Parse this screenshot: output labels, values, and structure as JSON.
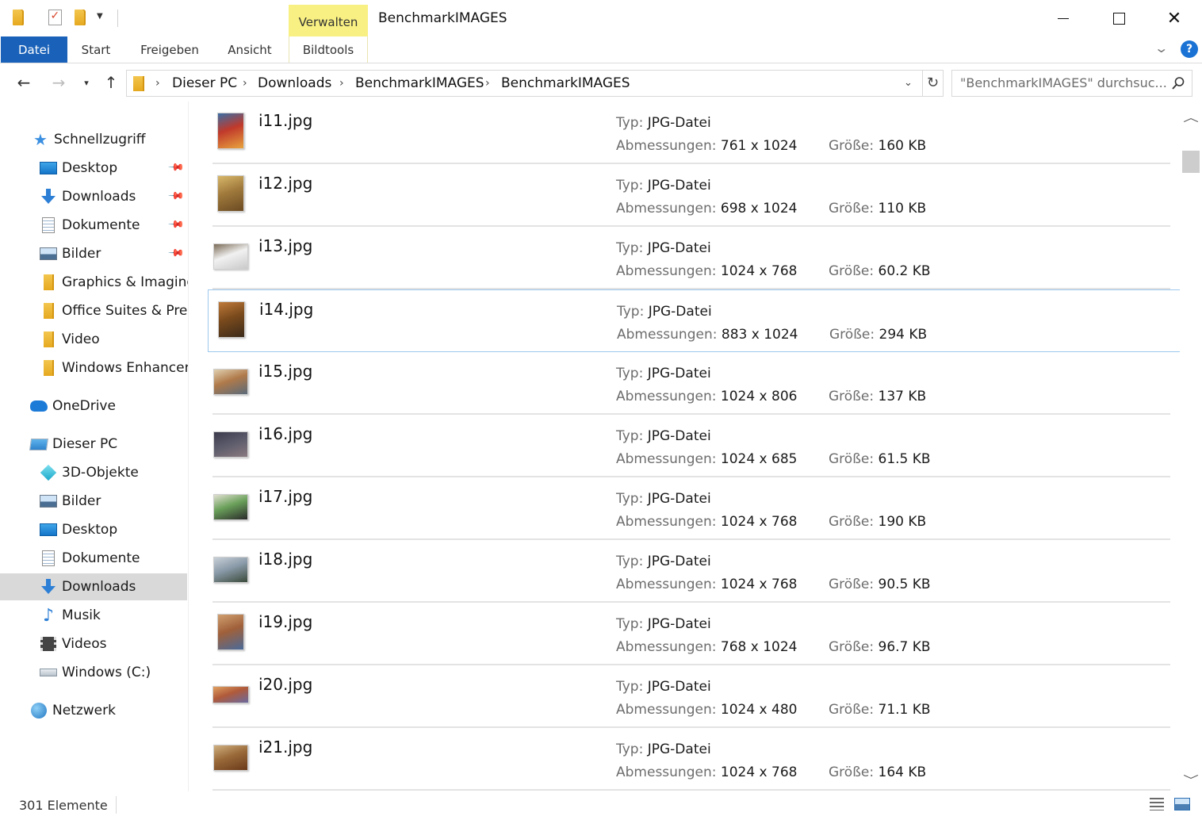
{
  "window": {
    "title": "BenchmarkIMAGES",
    "context_tab_header": "Verwalten"
  },
  "ribbon": {
    "tabs": [
      "Datei",
      "Start",
      "Freigeben",
      "Ansicht",
      "Bildtools"
    ],
    "help_label": "?"
  },
  "address": {
    "breadcrumbs": [
      "Dieser PC",
      "Downloads",
      "BenchmarkIMAGES",
      "BenchmarkIMAGES"
    ]
  },
  "search": {
    "placeholder": "\"BenchmarkIMAGES\" durchsuc..."
  },
  "navpane": {
    "quick_access": {
      "label": "Schnellzugriff",
      "items": [
        {
          "label": "Desktop",
          "icon": "desktop-icon",
          "pinned": true
        },
        {
          "label": "Downloads",
          "icon": "downloads-icon",
          "pinned": true
        },
        {
          "label": "Dokumente",
          "icon": "documents-icon",
          "pinned": true
        },
        {
          "label": "Bilder",
          "icon": "pictures-icon",
          "pinned": true
        },
        {
          "label": "Graphics & Imaging",
          "icon": "folder-icon",
          "pinned": false
        },
        {
          "label": "Office Suites & Pres",
          "icon": "folder-icon",
          "pinned": false
        },
        {
          "label": "Video",
          "icon": "folder-icon",
          "pinned": false
        },
        {
          "label": "Windows Enhancers",
          "icon": "folder-icon",
          "pinned": false
        }
      ]
    },
    "onedrive": {
      "label": "OneDrive"
    },
    "this_pc": {
      "label": "Dieser PC",
      "items": [
        {
          "label": "3D-Objekte",
          "icon": "3d-objects-icon"
        },
        {
          "label": "Bilder",
          "icon": "pictures-icon"
        },
        {
          "label": "Desktop",
          "icon": "desktop-icon"
        },
        {
          "label": "Dokumente",
          "icon": "documents-icon"
        },
        {
          "label": "Downloads",
          "icon": "downloads-icon",
          "selected": true
        },
        {
          "label": "Musik",
          "icon": "music-icon"
        },
        {
          "label": "Videos",
          "icon": "videos-icon"
        },
        {
          "label": "Windows (C:)",
          "icon": "drive-icon"
        }
      ]
    },
    "network": {
      "label": "Netzwerk"
    }
  },
  "labels": {
    "type": "Typ:",
    "dimensions": "Abmessungen:",
    "size": "Größe:"
  },
  "files": [
    {
      "name": "i11.jpg",
      "type": "JPG-Datei",
      "dimensions": "761 x 1024",
      "size": "160 KB",
      "thumb_colors": [
        "#c0392b",
        "#e8a33d",
        "#3a6ea5"
      ],
      "orientation": "portrait"
    },
    {
      "name": "i12.jpg",
      "type": "JPG-Datei",
      "dimensions": "698 x 1024",
      "size": "110 KB",
      "thumb_colors": [
        "#a07a3c",
        "#6b4a22",
        "#d8b86a"
      ],
      "orientation": "portrait"
    },
    {
      "name": "i13.jpg",
      "type": "JPG-Datei",
      "dimensions": "1024 x 768",
      "size": "60.2 KB",
      "thumb_colors": [
        "#f1f1f1",
        "#c9c9c9",
        "#7a6a55"
      ],
      "orientation": "landscape"
    },
    {
      "name": "i14.jpg",
      "type": "JPG-Datei",
      "dimensions": "883 x 1024",
      "size": "294 KB",
      "thumb_colors": [
        "#7a4a1c",
        "#3b2a1a",
        "#c07a3a"
      ],
      "orientation": "portrait",
      "focused": true
    },
    {
      "name": "i15.jpg",
      "type": "JPG-Datei",
      "dimensions": "1024 x 806",
      "size": "137 KB",
      "thumb_colors": [
        "#b07a4a",
        "#5a6a7a",
        "#e0d0b0"
      ],
      "orientation": "landscape"
    },
    {
      "name": "i16.jpg",
      "type": "JPG-Datei",
      "dimensions": "1024 x 685",
      "size": "61.5 KB",
      "thumb_colors": [
        "#5a5a6a",
        "#8a7a80",
        "#3a3a4a"
      ],
      "orientation": "landscape"
    },
    {
      "name": "i17.jpg",
      "type": "JPG-Datei",
      "dimensions": "1024 x 768",
      "size": "190 KB",
      "thumb_colors": [
        "#6aa05a",
        "#2a2a2a",
        "#e0e0d0"
      ],
      "orientation": "landscape"
    },
    {
      "name": "i18.jpg",
      "type": "JPG-Datei",
      "dimensions": "1024 x 768",
      "size": "90.5 KB",
      "thumb_colors": [
        "#8a9aa8",
        "#3a4a3a",
        "#c8d0d8"
      ],
      "orientation": "landscape"
    },
    {
      "name": "i19.jpg",
      "type": "JPG-Datei",
      "dimensions": "768 x 1024",
      "size": "96.7 KB",
      "thumb_colors": [
        "#a0603a",
        "#4a6a9a",
        "#d0a070"
      ],
      "orientation": "portrait"
    },
    {
      "name": "i20.jpg",
      "type": "JPG-Datei",
      "dimensions": "1024 x 480",
      "size": "71.1 KB",
      "thumb_colors": [
        "#b05a3a",
        "#6a6aa0",
        "#e0a060"
      ],
      "orientation": "wide"
    },
    {
      "name": "i21.jpg",
      "type": "JPG-Datei",
      "dimensions": "1024 x 768",
      "size": "164 KB",
      "thumb_colors": [
        "#9a6a3a",
        "#6a3a1a",
        "#d0b080"
      ],
      "orientation": "landscape"
    }
  ],
  "status": {
    "count": "301 Elemente"
  },
  "colors": {
    "accent": "#1a62b9",
    "context_tab": "#f8f082",
    "selection": "#d9d9d9",
    "focus_border": "#9dc9ee"
  }
}
